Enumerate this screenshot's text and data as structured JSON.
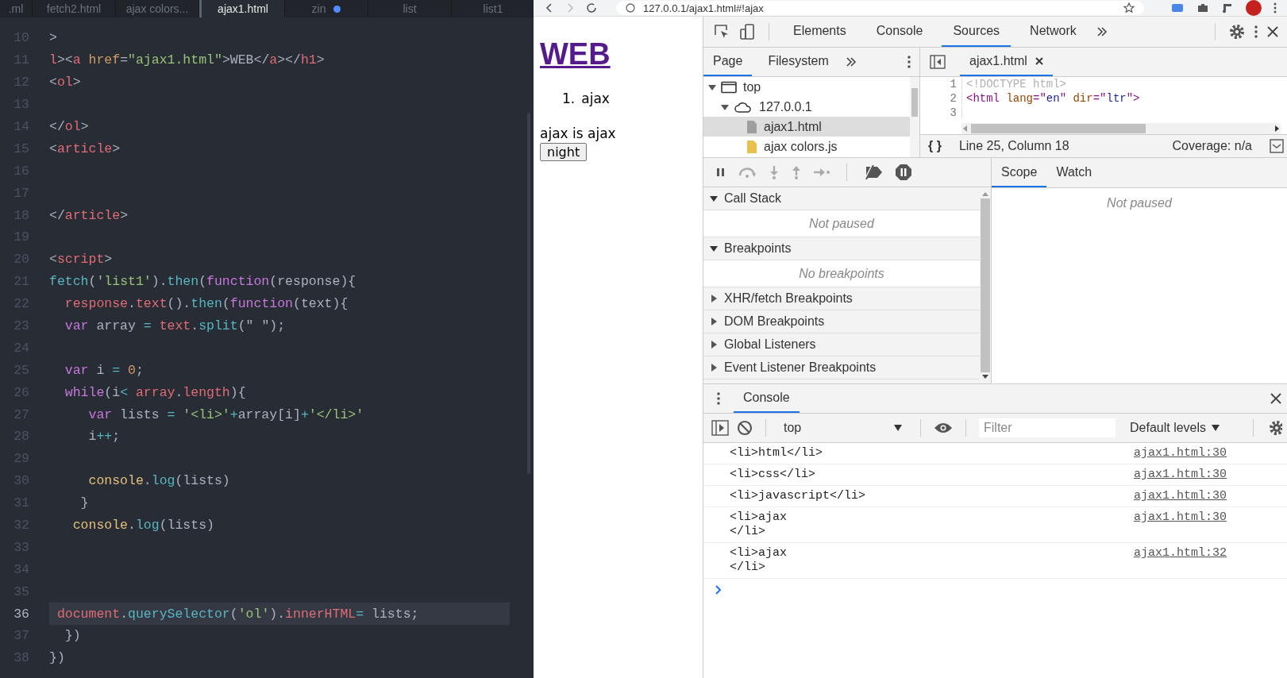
{
  "editor": {
    "tabs": [
      {
        "label": ".ml",
        "selected": false,
        "modified": false
      },
      {
        "label": "fetch2.html",
        "selected": false,
        "modified": false
      },
      {
        "label": "ajax colors...",
        "selected": false,
        "modified": false
      },
      {
        "label": "ajax1.html",
        "selected": true,
        "modified": false
      },
      {
        "label": "zin",
        "selected": false,
        "modified": true
      },
      {
        "label": "list",
        "selected": false,
        "modified": false
      },
      {
        "label": "list1",
        "selected": false,
        "modified": false
      }
    ],
    "lines": [
      {
        "number": "10",
        "current": false,
        "tokens": [
          {
            "text": ">",
            "kind": "plain"
          }
        ]
      },
      {
        "number": "11",
        "current": false,
        "tokens": [
          {
            "text": "l",
            "kind": "tag"
          },
          {
            "text": "><",
            "kind": "plain"
          },
          {
            "text": "a",
            "kind": "tag"
          },
          {
            "text": " href",
            "kind": "attr"
          },
          {
            "text": "=",
            "kind": "plain"
          },
          {
            "text": "\"ajax1.html\"",
            "kind": "string"
          },
          {
            "text": ">WEB</",
            "kind": "plain"
          },
          {
            "text": "a",
            "kind": "tag"
          },
          {
            "text": "></",
            "kind": "plain"
          },
          {
            "text": "h1",
            "kind": "tag"
          },
          {
            "text": ">",
            "kind": "plain"
          }
        ]
      },
      {
        "number": "12",
        "current": false,
        "tokens": [
          {
            "text": "<",
            "kind": "plain"
          },
          {
            "text": "ol",
            "kind": "tag"
          },
          {
            "text": ">",
            "kind": "plain"
          }
        ]
      },
      {
        "number": "13",
        "current": false
      },
      {
        "number": "14",
        "current": false,
        "tokens": [
          {
            "text": "</",
            "kind": "plain"
          },
          {
            "text": "ol",
            "kind": "tag"
          },
          {
            "text": ">",
            "kind": "plain"
          }
        ]
      },
      {
        "number": "15",
        "current": false,
        "tokens": [
          {
            "text": "<",
            "kind": "plain"
          },
          {
            "text": "article",
            "kind": "tag"
          },
          {
            "text": ">",
            "kind": "plain"
          }
        ]
      },
      {
        "number": "16",
        "current": false
      },
      {
        "number": "17",
        "current": false
      },
      {
        "number": "18",
        "current": false,
        "tokens": [
          {
            "text": "</",
            "kind": "plain"
          },
          {
            "text": "article",
            "kind": "tag"
          },
          {
            "text": ">",
            "kind": "plain"
          }
        ]
      },
      {
        "number": "19",
        "current": false
      },
      {
        "number": "20",
        "current": false,
        "tokens": [
          {
            "text": "<",
            "kind": "plain"
          },
          {
            "text": "script",
            "kind": "tag"
          },
          {
            "text": ">",
            "kind": "plain"
          }
        ]
      },
      {
        "number": "21",
        "current": false,
        "tokens": [
          {
            "text": "fetch",
            "kind": "func"
          },
          {
            "text": "(",
            "kind": "plain"
          },
          {
            "text": "'list1'",
            "kind": "string"
          },
          {
            "text": ").",
            "kind": "plain"
          },
          {
            "text": "then",
            "kind": "func"
          },
          {
            "text": "(",
            "kind": "plain"
          },
          {
            "text": "function",
            "kind": "keyword"
          },
          {
            "text": "(response){",
            "kind": "plain"
          }
        ]
      },
      {
        "number": "22",
        "current": false,
        "tokens": [
          {
            "text": "  response",
            "kind": "tag"
          },
          {
            "text": ".",
            "kind": "plain"
          },
          {
            "text": "text",
            "kind": "tag"
          },
          {
            "text": "().",
            "kind": "plain"
          },
          {
            "text": "then",
            "kind": "func"
          },
          {
            "text": "(",
            "kind": "plain"
          },
          {
            "text": "function",
            "kind": "keyword"
          },
          {
            "text": "(text){",
            "kind": "plain"
          }
        ]
      },
      {
        "number": "23",
        "current": false,
        "tokens": [
          {
            "text": "  var",
            "kind": "keyword"
          },
          {
            "text": " array ",
            "kind": "plain"
          },
          {
            "text": "=",
            "kind": "op"
          },
          {
            "text": " text",
            "kind": "tag"
          },
          {
            "text": ".",
            "kind": "plain"
          },
          {
            "text": "split",
            "kind": "func"
          },
          {
            "text": "(\" \");",
            "kind": "plain"
          }
        ]
      },
      {
        "number": "24",
        "current": false
      },
      {
        "number": "25",
        "current": false,
        "tokens": [
          {
            "text": "  var",
            "kind": "keyword"
          },
          {
            "text": " i ",
            "kind": "plain"
          },
          {
            "text": "=",
            "kind": "op"
          },
          {
            "text": " 0",
            "kind": "number"
          },
          {
            "text": ";",
            "kind": "plain"
          }
        ]
      },
      {
        "number": "26",
        "current": false,
        "tokens": [
          {
            "text": "  while",
            "kind": "keyword"
          },
          {
            "text": "(i",
            "kind": "plain"
          },
          {
            "text": "<",
            "kind": "op"
          },
          {
            "text": " array",
            "kind": "tag"
          },
          {
            "text": ".",
            "kind": "plain"
          },
          {
            "text": "length",
            "kind": "tag"
          },
          {
            "text": "){",
            "kind": "plain"
          }
        ]
      },
      {
        "number": "27",
        "current": false,
        "tokens": [
          {
            "text": "     var",
            "kind": "keyword"
          },
          {
            "text": " lists ",
            "kind": "plain"
          },
          {
            "text": "=",
            "kind": "op"
          },
          {
            "text": " '<li>'",
            "kind": "string"
          },
          {
            "text": "+",
            "kind": "op"
          },
          {
            "text": "array[i]",
            "kind": "plain"
          },
          {
            "text": "+",
            "kind": "op"
          },
          {
            "text": "'</li>'",
            "kind": "string"
          }
        ]
      },
      {
        "number": "28",
        "current": false,
        "tokens": [
          {
            "text": "     i",
            "kind": "plain"
          },
          {
            "text": "++",
            "kind": "op"
          },
          {
            "text": ";",
            "kind": "plain"
          }
        ]
      },
      {
        "number": "29",
        "current": false
      },
      {
        "number": "30",
        "current": false,
        "tokens": [
          {
            "text": "     console",
            "kind": "object"
          },
          {
            "text": ".",
            "kind": "plain"
          },
          {
            "text": "log",
            "kind": "func"
          },
          {
            "text": "(lists)",
            "kind": "plain"
          }
        ]
      },
      {
        "number": "31",
        "current": false,
        "tokens": [
          {
            "text": "    }",
            "kind": "plain"
          }
        ]
      },
      {
        "number": "32",
        "current": false,
        "tokens": [
          {
            "text": "   console",
            "kind": "object"
          },
          {
            "text": ".",
            "kind": "plain"
          },
          {
            "text": "log",
            "kind": "func"
          },
          {
            "text": "(lists)",
            "kind": "plain"
          }
        ]
      },
      {
        "number": "33",
        "current": false
      },
      {
        "number": "34",
        "current": false
      },
      {
        "number": "35",
        "current": false
      },
      {
        "number": "36",
        "current": true,
        "tokens": [
          {
            "text": " document",
            "kind": "tag"
          },
          {
            "text": ".",
            "kind": "plain"
          },
          {
            "text": "querySelector",
            "kind": "func"
          },
          {
            "text": "(",
            "kind": "plain"
          },
          {
            "text": "'ol'",
            "kind": "string"
          },
          {
            "text": ").",
            "kind": "plain"
          },
          {
            "text": "innerHTML",
            "kind": "tag"
          },
          {
            "text": "=",
            "kind": "op"
          },
          {
            "text": " lists;",
            "kind": "plain"
          }
        ]
      },
      {
        "number": "37",
        "current": false,
        "tokens": [
          {
            "text": "  })",
            "kind": "plain"
          }
        ]
      },
      {
        "number": "38",
        "current": false,
        "tokens": [
          {
            "text": "})",
            "kind": "plain"
          }
        ]
      }
    ]
  },
  "browser": {
    "address": "127.0.0.1/ajax1.html#!ajax",
    "page": {
      "heading": "WEB",
      "list": [
        {
          "marker": "1.",
          "text": "ajax"
        }
      ],
      "article": "ajax is ajax",
      "button": "night"
    }
  },
  "devtools": {
    "tabs": [
      {
        "label": "Elements",
        "selected": false
      },
      {
        "label": "Console",
        "selected": false
      },
      {
        "label": "Sources",
        "selected": true
      },
      {
        "label": "Network",
        "selected": false
      }
    ],
    "navigator": {
      "tabs": [
        {
          "label": "Page",
          "selected": true
        },
        {
          "label": "Filesystem",
          "selected": false
        }
      ],
      "tree": [
        {
          "label": "top",
          "kind": "frame",
          "expanded": true,
          "selected": false,
          "children": [
            {
              "label": "127.0.0.1",
              "kind": "domain",
              "expanded": true,
              "selected": false,
              "children": [
                {
                  "label": "ajax1.html",
                  "kind": "file",
                  "selected": true
                },
                {
                  "label": "ajax colors.js",
                  "kind": "script",
                  "selected": false
                }
              ]
            }
          ]
        }
      ]
    },
    "source": {
      "tab": "ajax1.html",
      "lines": [
        {
          "number": "1",
          "tokens": [
            {
              "text": "<!DOCTYPE html>",
              "kind": "doctype"
            }
          ]
        },
        {
          "number": "2",
          "tokens": [
            {
              "text": "<html",
              "kind": "tag"
            },
            {
              "text": " lang",
              "kind": "attr"
            },
            {
              "text": "=\"",
              "kind": "tag"
            },
            {
              "text": "en",
              "kind": "value"
            },
            {
              "text": "\"",
              "kind": "tag"
            },
            {
              "text": " dir",
              "kind": "attr"
            },
            {
              "text": "=\"",
              "kind": "tag"
            },
            {
              "text": "ltr",
              "kind": "value"
            },
            {
              "text": "\">",
              "kind": "tag"
            }
          ]
        },
        {
          "number": "3"
        }
      ],
      "format": "{ }",
      "position": "Line 25, Column 18",
      "coverage": "Coverage: n/a"
    },
    "debugger": {
      "sections": [
        {
          "title": "Call Stack",
          "expanded": true,
          "message": "Not paused"
        },
        {
          "title": "Breakpoints",
          "expanded": true,
          "message": "No breakpoints"
        },
        {
          "title": "XHR/fetch Breakpoints",
          "expanded": false
        },
        {
          "title": "DOM Breakpoints",
          "expanded": false
        },
        {
          "title": "Global Listeners",
          "expanded": false
        },
        {
          "title": "Event Listener Breakpoints",
          "expanded": false
        }
      ],
      "side_tabs": [
        {
          "label": "Scope",
          "selected": true
        },
        {
          "label": "Watch",
          "selected": false
        }
      ],
      "side_message": "Not paused"
    },
    "console": {
      "title": "Console",
      "context": "top",
      "filter_placeholder": "Filter",
      "levels": "Default levels",
      "messages": [
        {
          "text": "<li>html</li>",
          "source": "ajax1.html:30"
        },
        {
          "text": "<li>css</li>",
          "source": "ajax1.html:30"
        },
        {
          "text": "<li>javascript</li>",
          "source": "ajax1.html:30"
        },
        {
          "text": "<li>ajax\n</li>",
          "source": "ajax1.html:30"
        },
        {
          "text": "<li>ajax\n</li>",
          "source": "ajax1.html:32"
        }
      ]
    }
  }
}
